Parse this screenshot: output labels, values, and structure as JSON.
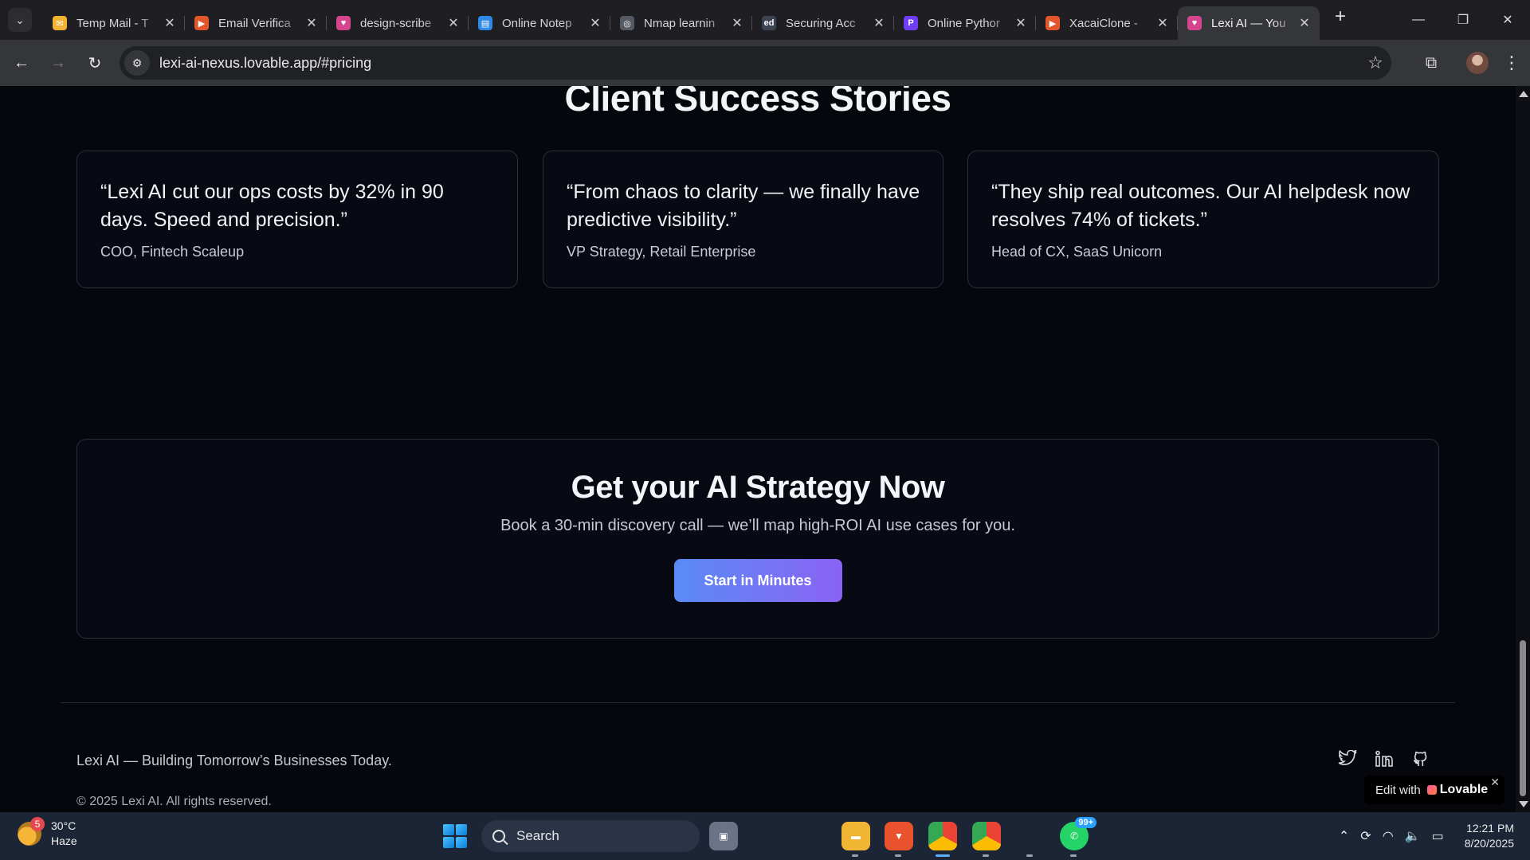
{
  "browser": {
    "tabs": [
      {
        "title": "Temp Mail - T",
        "fav_color": "#f2b233",
        "fav_glyph": "✉",
        "active": false
      },
      {
        "title": "Email Verifica",
        "fav_color": "#e3562b",
        "fav_glyph": "▶",
        "active": false
      },
      {
        "title": "design-scribe",
        "fav_color": "#d4458e",
        "fav_glyph": "♥",
        "active": false
      },
      {
        "title": "Online Notep",
        "fav_color": "#2f88e8",
        "fav_glyph": "▤",
        "active": false
      },
      {
        "title": "Nmap learnin",
        "fav_color": "#555a63",
        "fav_glyph": "◎",
        "active": false
      },
      {
        "title": "Securing Acc",
        "fav_color": "#3b4252",
        "fav_glyph": "ed",
        "active": false
      },
      {
        "title": "Online Pythor",
        "fav_color": "#6f3df5",
        "fav_glyph": "P",
        "active": false
      },
      {
        "title": "XacaiClone -",
        "fav_color": "#e3562b",
        "fav_glyph": "▶",
        "active": false
      },
      {
        "title": "Lexi AI — You",
        "fav_color": "#d4458e",
        "fav_glyph": "♥",
        "active": true
      }
    ],
    "url": "lexi-ai-nexus.lovable.app/#pricing"
  },
  "page": {
    "section_title": "Client Success Stories",
    "testimonials": [
      {
        "quote": "“Lexi AI cut our ops costs by 32% in 90 days. Speed and precision.”",
        "author": "COO, Fintech Scaleup"
      },
      {
        "quote": "“From chaos to clarity — we finally have predictive visibility.”",
        "author": "VP Strategy, Retail Enterprise"
      },
      {
        "quote": "“They ship real outcomes. Our AI helpdesk now resolves 74% of tickets.”",
        "author": "Head of CX, SaaS Unicorn"
      }
    ],
    "cta": {
      "title": "Get your AI Strategy Now",
      "subtitle": "Book a 30-min discovery call — we’ll map high-ROI AI use cases for you.",
      "button": "Start in Minutes"
    },
    "footer": {
      "tagline": "Lexi AI — Building Tomorrow’s Businesses Today.",
      "copyright": "© 2025 Lexi AI. All rights reserved."
    },
    "lovable_badge": {
      "prefix": "Edit with",
      "brand": "Lovable"
    }
  },
  "taskbar": {
    "weather_temp": "30°C",
    "weather_desc": "Haze",
    "weather_badge": "5",
    "search_label": "Search",
    "whatsapp_badge": "99+",
    "time": "12:21 PM",
    "date": "8/20/2025"
  }
}
